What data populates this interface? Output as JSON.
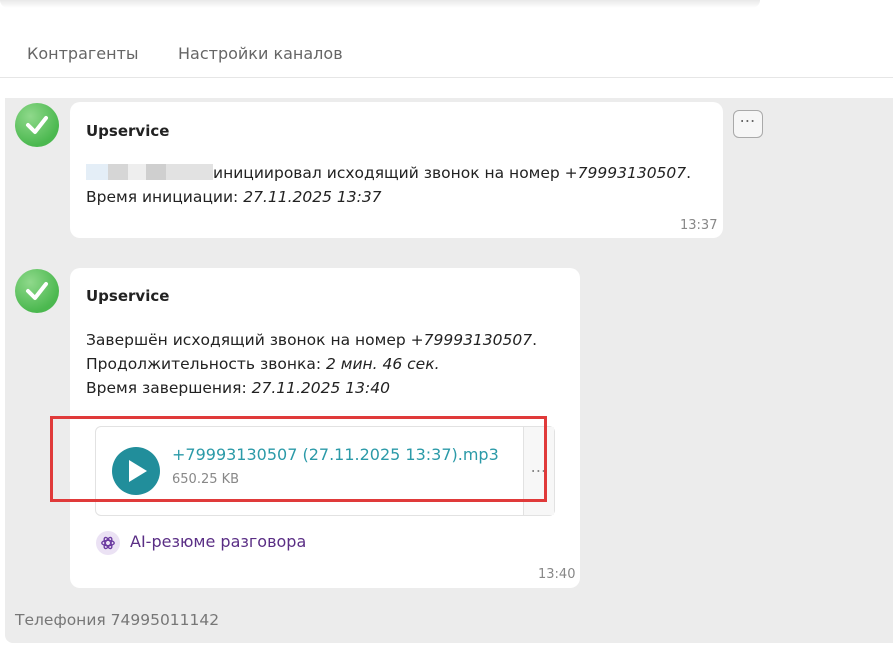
{
  "tabs": [
    {
      "label": "Контрагенты"
    },
    {
      "label": "Настройки каналов"
    }
  ],
  "messages": [
    {
      "sender": "Upservice",
      "line1_text": "инициировал исходящий звонок на номер ",
      "line1_value": "+79993130507",
      "line1_end": ".",
      "line2_label": "Время инициации: ",
      "line2_value": "27.11.2025 13:37",
      "time": "13:37",
      "more_label": "⋯"
    },
    {
      "sender": "Upservice",
      "line1_label": "Завершён исходящий звонок на номер ",
      "line1_value": "+79993130507",
      "line1_end": ".",
      "line2_label": "Продолжительность звонка: ",
      "line2_value": "2 мин. 46 сек.",
      "line3_label": "Время завершения: ",
      "line3_value": "27.11.2025 13:40",
      "attachment": {
        "file_name": "+79993130507 (27.11.2025 13:37).mp3",
        "file_size": "650.25 KB",
        "more_label": "⋯"
      },
      "ai_summary_label": "AI-резюме разговора",
      "time": "13:40"
    }
  ],
  "footer": {
    "channel": "Телефония 74995011142"
  },
  "colors": {
    "accent": "#218e9b",
    "ai": "#5a2e85",
    "highlight": "#e03a3a",
    "avatar": "#4bb84f"
  },
  "icons": {
    "avatar": "check-icon",
    "play": "play-icon",
    "ai": "openai-icon",
    "more": "more-horizontal-icon"
  }
}
